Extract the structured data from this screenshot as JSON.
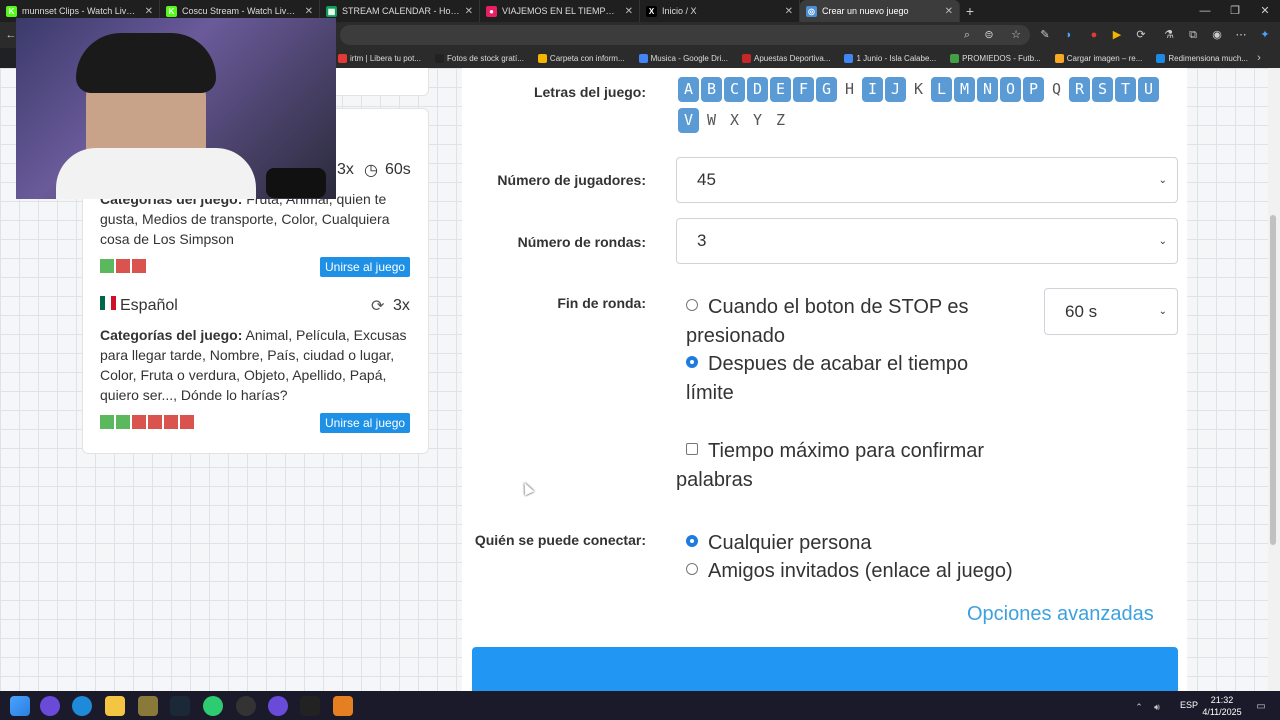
{
  "browser": {
    "tabs": [
      {
        "title": "munnset Clips - Watch Live on Ki",
        "icon_color": "#53fc18",
        "icon": "K"
      },
      {
        "title": "Coscu Stream - Watch Live on Ki",
        "icon_color": "#53fc18",
        "icon": "K"
      },
      {
        "title": "STREAM CALENDAR - Hojas de c",
        "icon_color": "#0f9d58",
        "icon": "▦"
      },
      {
        "title": "VIAJEMOS EN EL TIEMPO #",
        "icon_color": "#e91e63",
        "icon": "●"
      },
      {
        "title": "Inicio / X",
        "icon_color": "#000000",
        "icon": "X"
      },
      {
        "title": "Crear un nuevo juego",
        "icon_color": "#4a90d9",
        "icon": "◎"
      }
    ],
    "new_tab": "+",
    "bookmarks": [
      {
        "label": "irtm | Libera tu pot...",
        "color": "#e53935"
      },
      {
        "label": "Fotos de stock gratí...",
        "color": "#222222"
      },
      {
        "label": "Carpeta con inform...",
        "color": "#f4b400"
      },
      {
        "label": "Musica - Google Dri...",
        "color": "#4285f4"
      },
      {
        "label": "Apuestas Deportiva...",
        "color": "#c62828"
      },
      {
        "label": "1 Junio - Isla Calabe...",
        "color": "#4285f4"
      },
      {
        "label": "PROMIEDOS - Futb...",
        "color": "#43a047"
      },
      {
        "label": "Cargar imagen – re...",
        "color": "#f9a825"
      },
      {
        "label": "Redimensiona much...",
        "color": "#1e88e5"
      }
    ]
  },
  "left_list": {
    "game1": {
      "rounds": "3x",
      "time": "60s",
      "categories_label": "Categorías del juego:",
      "categories": "Fruta, Animal, quien te gusta, Medios de transporte, Color, Cualquiera cosa de Los Simpson",
      "players": [
        "g",
        "r",
        "r"
      ],
      "join_label": "Unirse al juego"
    },
    "game2": {
      "language": "Español",
      "rounds": "3x",
      "categories_label": "Categorías del juego:",
      "categories": "Animal, Película, Excusas para llegar tarde, Nombre, País, ciudad o lugar, Color, Fruta o verdura, Objeto, Apellido, Papá, quiero ser..., Dónde lo harías?",
      "players": [
        "g",
        "g",
        "r",
        "r",
        "r",
        "r"
      ],
      "join_label": "Unirse al juego"
    }
  },
  "form": {
    "letters_label": "Letras del juego:",
    "letters": [
      {
        "l": "A",
        "on": true
      },
      {
        "l": "B",
        "on": true
      },
      {
        "l": "C",
        "on": true
      },
      {
        "l": "D",
        "on": true
      },
      {
        "l": "E",
        "on": true
      },
      {
        "l": "F",
        "on": true
      },
      {
        "l": "G",
        "on": true
      },
      {
        "l": "H",
        "on": false
      },
      {
        "l": "I",
        "on": true
      },
      {
        "l": "J",
        "on": true
      },
      {
        "l": "K",
        "on": false
      },
      {
        "l": "L",
        "on": true
      },
      {
        "l": "M",
        "on": true
      },
      {
        "l": "N",
        "on": true
      },
      {
        "l": "O",
        "on": true
      },
      {
        "l": "P",
        "on": true
      },
      {
        "l": "Q",
        "on": false
      },
      {
        "l": "R",
        "on": true
      },
      {
        "l": "S",
        "on": true
      },
      {
        "l": "T",
        "on": true
      },
      {
        "l": "U",
        "on": true
      },
      {
        "l": "V",
        "on": true
      },
      {
        "l": "W",
        "on": false
      },
      {
        "l": "X",
        "on": false
      },
      {
        "l": "Y",
        "on": false
      },
      {
        "l": "Z",
        "on": false
      }
    ],
    "players_label": "Número de jugadores:",
    "players_value": "45",
    "rounds_label": "Número de rondas:",
    "rounds_value": "3",
    "round_end_label": "Fin de ronda:",
    "round_end_opt1": "Cuando el boton de STOP es presionado",
    "round_end_opt2": "Despues de acabar el tiempo límite",
    "time_value": "60 s",
    "confirm_label": "Tiempo máximo para confirmar palabras",
    "who_label": "Quién se puede conectar:",
    "who_opt1": "Cualquier persona",
    "who_opt2": "Amigos invitados (enlace al juego)",
    "advanced": "Opciones avanzadas"
  },
  "taskbar": {
    "lang": "ESP",
    "time": "21:32",
    "date": "4/11/2025"
  }
}
